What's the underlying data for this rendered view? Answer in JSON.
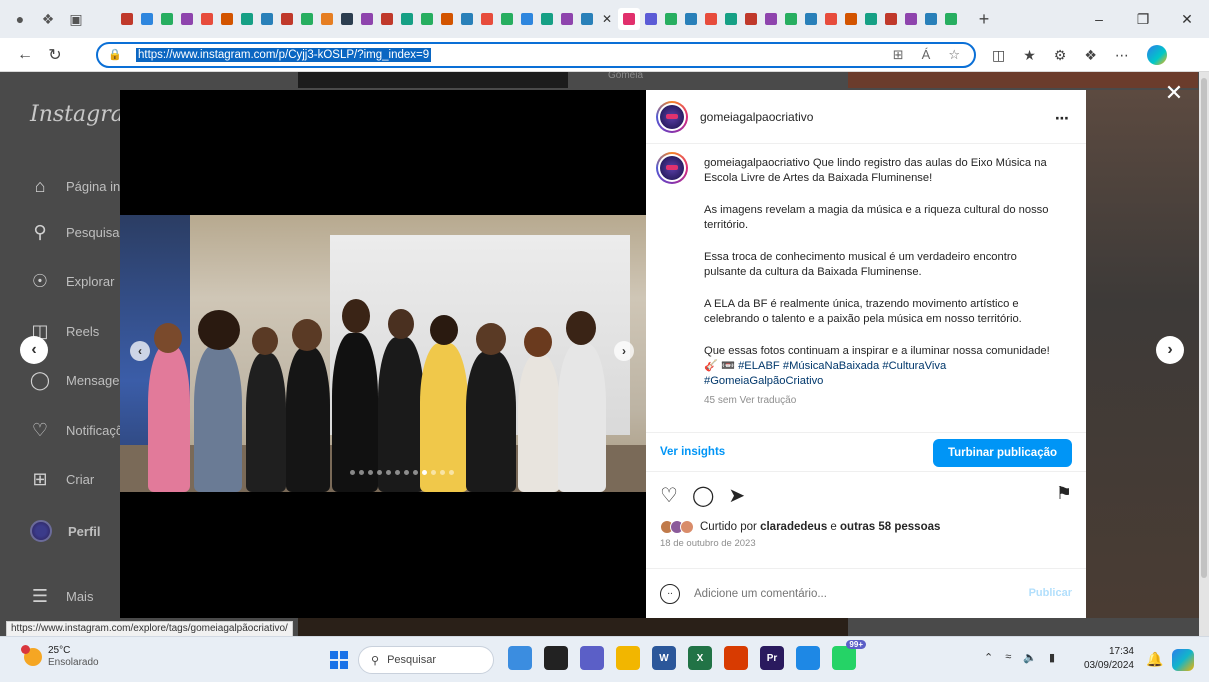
{
  "browser": {
    "url": "https://www.instagram.com/p/Cyjj3-kOSLP/?img_index=9",
    "tab_favicon_colors": [
      "#c0392b",
      "#2e86de",
      "#27ae60",
      "#8e44ad",
      "#e74c3c",
      "#d35400",
      "#16a085",
      "#2980b9",
      "#c0392b",
      "#27ae60",
      "#e67e22",
      "#2c3e50",
      "#8e44ad",
      "#c0392b",
      "#16a085",
      "#27ae60",
      "#d35400",
      "#2980b9",
      "#e74c3c",
      "#27ae60",
      "#2e86de",
      "#16a085",
      "#8e44ad",
      "#2980b9"
    ],
    "tab_favicon_colors_after": [
      "#e1306c",
      "#5b5bd6",
      "#27ae60",
      "#2980b9",
      "#e74c3c",
      "#16a085",
      "#c0392b",
      "#8e44ad",
      "#27ae60",
      "#2980b9",
      "#e74c3c",
      "#d35400",
      "#16a085",
      "#c0392b",
      "#8e44ad",
      "#2980b9",
      "#27ae60"
    ],
    "new_tab_label": "+",
    "window_controls": {
      "minimize": "–",
      "restore": "❐",
      "close": "✕"
    }
  },
  "instagram_sidebar": {
    "logo": "Instagram",
    "items": [
      {
        "label": "Página inicial",
        "icon": "home-icon"
      },
      {
        "label": "Pesquisa",
        "icon": "search-icon"
      },
      {
        "label": "Explorar",
        "icon": "compass-icon"
      },
      {
        "label": "Reels",
        "icon": "reels-icon"
      },
      {
        "label": "Mensagens",
        "icon": "messenger-icon"
      },
      {
        "label": "Notificações",
        "icon": "heart-icon"
      },
      {
        "label": "Criar",
        "icon": "plus-square-icon"
      },
      {
        "label": "Perfil",
        "icon": "avatar"
      },
      {
        "label": "Mais",
        "icon": "menu-icon"
      }
    ]
  },
  "background_snippet": "Gomeia",
  "post": {
    "username": "gomeiagalpaocriativo",
    "caption_paragraphs": [
      "Que lindo registro das aulas do Eixo Música na Escola Livre de Artes da Baixada Fluminense!",
      "As imagens revelam a magia da música e a riqueza cultural do nosso território.",
      "Essa troca de conhecimento musical é um verdadeiro encontro pulsante da cultura da Baixada Fluminense.",
      "A ELA da BF é realmente única, trazendo movimento artístico e celebrando o talento e a paixão pela música em nosso território.",
      "Que essas fotos continuam a inspirar e a iluminar nossa comunidade!"
    ],
    "hashtags": "🎸 📼 #ELABF #MúsicaNaBaixada #CulturaViva #GomeiaGalpãoCriativo",
    "caption_meta": "45 sem   Ver tradução",
    "insights_label": "Ver insights",
    "boost_label": "Turbinar publicação",
    "liked_by_prefix": "Curtido por",
    "liked_by_user": "claradedeus",
    "liked_by_conj": "e",
    "liked_by_others": "outras 58 pessoas",
    "date": "18 de outubro de 2023",
    "comment_placeholder": "Adicione um comentário...",
    "publish_label": "Publicar",
    "carousel_dots": 12,
    "carousel_active_dot": 9
  },
  "status_bar_url": "https://www.instagram.com/explore/tags/gomeiagalpãocriativo/",
  "taskbar": {
    "weather_temp": "25°C",
    "weather_desc": "Ensolarado",
    "search_label": "Pesquisar",
    "apps": [
      {
        "name": "widgets-app",
        "color": "#3b8de0",
        "glyph": ""
      },
      {
        "name": "terminal-app",
        "color": "#222222",
        "glyph": ""
      },
      {
        "name": "teams-app",
        "color": "#5b5fc7",
        "glyph": ""
      },
      {
        "name": "file-explorer-app",
        "color": "#f2b600",
        "glyph": ""
      },
      {
        "name": "word-app",
        "color": "#2b579a",
        "glyph": "W"
      },
      {
        "name": "excel-app",
        "color": "#217346",
        "glyph": "X"
      },
      {
        "name": "office-app",
        "color": "#d83b01",
        "glyph": ""
      },
      {
        "name": "premiere-app",
        "color": "#2a1a5e",
        "glyph": "Pr"
      },
      {
        "name": "edge-app",
        "color": "#1e88e5",
        "glyph": ""
      },
      {
        "name": "whatsapp-app",
        "color": "#25d366",
        "glyph": ""
      }
    ],
    "whatsapp_badge": "99+",
    "time": "17:34",
    "date": "03/09/2024"
  }
}
